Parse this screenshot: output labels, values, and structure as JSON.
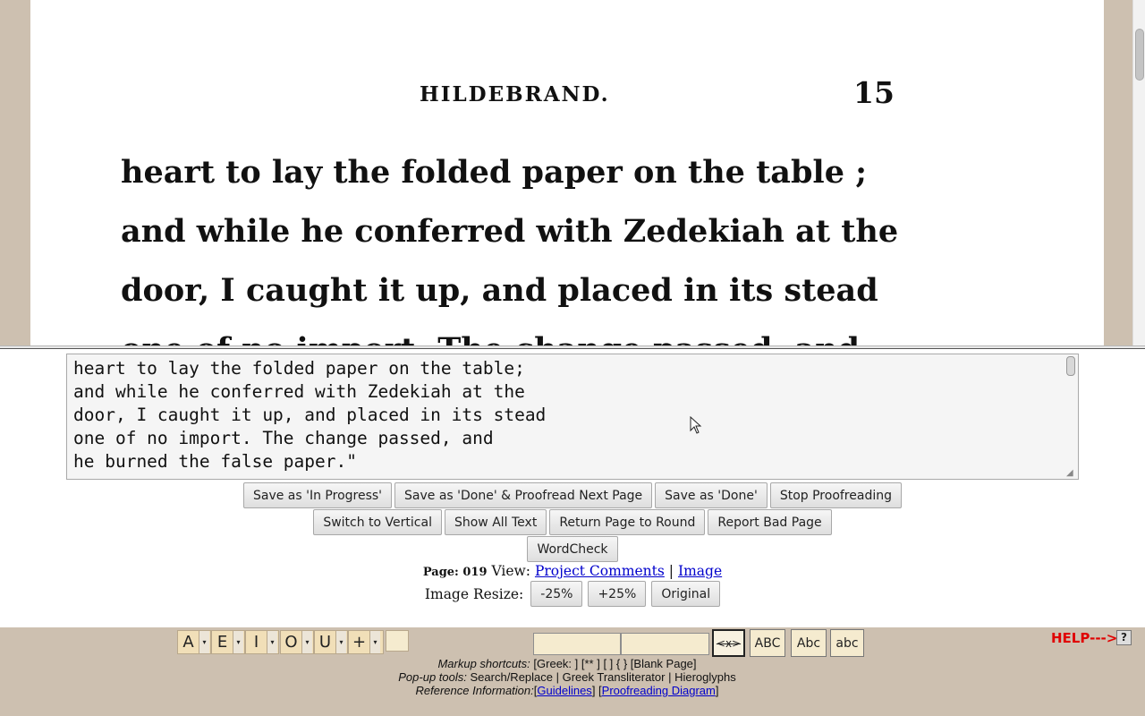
{
  "scan": {
    "running_head": "HILDEBRAND.",
    "page_number": "15",
    "lines": [
      "heart to lay the folded paper on the table ;",
      "and while he conferred with Zedekiah at the",
      "door, I caught it up, and placed in its stead",
      "one of no import. The change passed, and"
    ]
  },
  "editor": {
    "text": "heart to lay the folded paper on the table;\nand while he conferred with Zedekiah at the\ndoor, I caught it up, and placed in its stead\none of no import. The change passed, and\nhe burned the false paper.\""
  },
  "buttons": {
    "save_in_progress": "Save as 'In Progress'",
    "save_done_next": "Save as 'Done' & Proofread Next Page",
    "save_done": "Save as 'Done'",
    "stop": "Stop Proofreading",
    "switch_vertical": "Switch to Vertical",
    "show_all": "Show All Text",
    "return_page": "Return Page to Round",
    "report_bad": "Report Bad Page",
    "wordcheck": "WordCheck"
  },
  "page_info": {
    "page_label": "Page: 019",
    "view_label": "View:",
    "project_comments": "Project Comments",
    "separator": "|",
    "image_link": "Image"
  },
  "resize": {
    "label": "Image Resize:",
    "minus": "-25%",
    "plus": "+25%",
    "original": "Original"
  },
  "toolbar": {
    "vowels": [
      "A",
      "E",
      "I",
      "O",
      "U",
      "+"
    ],
    "arrow": "▾",
    "swap": "<x>",
    "upper": "ABC",
    "title": "Abc",
    "lower": "abc",
    "help": "HELP--->",
    "help_icon": "?",
    "markup_label": "Markup shortcuts:",
    "markup_items": "[Greek: ]   [** ]   [ ]   { }   [Blank Page]",
    "popup_label": "Pop-up tools:",
    "popup_items": "Search/Replace  | Greek Transliterator  | Hieroglyphs",
    "ref_label": "Reference Information:",
    "guidelines": "Guidelines",
    "diagram": "Proofreading Diagram",
    "lb": "[",
    "rb": "]",
    "rb_lb": "] ["
  },
  "colors": {
    "toolbar_bg": "#cdc0b0",
    "input_bg": "#f5ebcf",
    "help_red": "#e00000",
    "link": "#0000cc"
  }
}
